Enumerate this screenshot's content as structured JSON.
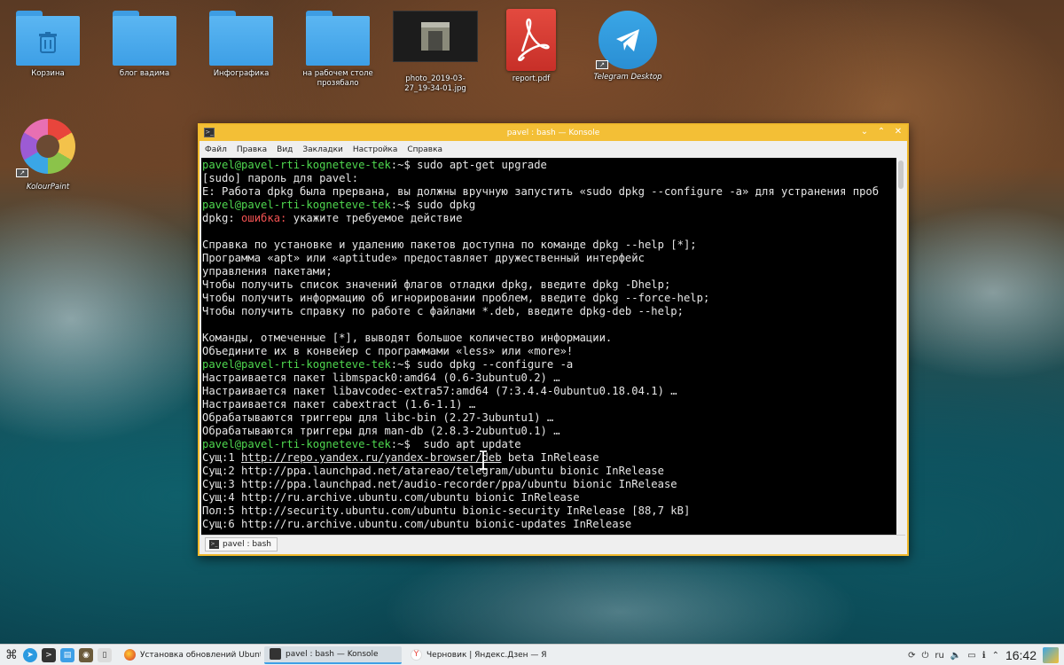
{
  "desktop": {
    "icons": [
      {
        "label": "Корзина",
        "kind": "trash"
      },
      {
        "label": "блог вадима",
        "kind": "folder"
      },
      {
        "label": "Инфографика",
        "kind": "folder"
      },
      {
        "label": "на рабочем столе прозябало",
        "kind": "folder"
      },
      {
        "label": "photo_2019-03-27_19-34-01.jpg",
        "kind": "image"
      },
      {
        "label": "report.pdf",
        "kind": "pdf"
      },
      {
        "label": "Telegram Desktop",
        "kind": "telegram"
      },
      {
        "label": "KolourPaint",
        "kind": "kolourpaint"
      }
    ]
  },
  "window": {
    "title": "pavel : bash — Konsole",
    "menu": [
      "Файл",
      "Правка",
      "Вид",
      "Закладки",
      "Настройка",
      "Справка"
    ],
    "tab_label": "pavel : bash"
  },
  "terminal": {
    "prompt": "pavel@pavel-rti-kogneteve-tek",
    "lines": [
      {
        "p": "pavel@pavel-rti-kogneteve-tek",
        "t": ":~$ sudo apt-get upgrade"
      },
      {
        "t": "[sudo] пароль для pavel:"
      },
      {
        "t": "E: Работа dpkg была прервана, вы должны вручную запустить «sudo dpkg --configure -a» для устранения проб"
      },
      {
        "p": "pavel@pavel-rti-kogneteve-tek",
        "t": ":~$ sudo dpkg"
      },
      {
        "a": "dpkg: ",
        "e": "ошибка:",
        "t": " укажите требуемое действие"
      },
      {
        "t": ""
      },
      {
        "t": "Справка по установке и удалению пакетов доступна по команде dpkg --help [*];"
      },
      {
        "t": "Программа «apt» или «aptitude» предоставляет дружественный интерфейс"
      },
      {
        "t": "управления пакетами;"
      },
      {
        "t": "Чтобы получить список значений флагов отладки dpkg, введите dpkg -Dhelp;"
      },
      {
        "t": "Чтобы получить информацию об игнорировании проблем, введите dpkg --force-help;"
      },
      {
        "t": "Чтобы получить справку по работе с файлами *.deb, введите dpkg-deb --help;"
      },
      {
        "t": ""
      },
      {
        "t": "Команды, отмеченные [*], выводят большое количество информации."
      },
      {
        "t": "Объедините их в конвейер с программами «less» или «more»!"
      },
      {
        "p": "pavel@pavel-rti-kogneteve-tek",
        "t": ":~$ sudo dpkg --configure -a"
      },
      {
        "t": "Настраивается пакет libmspack0:amd64 (0.6-3ubuntu0.2) …"
      },
      {
        "t": "Настраивается пакет libavcodec-extra57:amd64 (7:3.4.4-0ubuntu0.18.04.1) …"
      },
      {
        "t": "Настраивается пакет cabextract (1.6-1.1) …"
      },
      {
        "t": "Обрабатываются триггеры для libc-bin (2.27-3ubuntu1) …"
      },
      {
        "t": "Обрабатываются триггеры для man-db (2.8.3-2ubuntu0.1) …"
      },
      {
        "p": "pavel@pavel-rti-kogneteve-tek",
        "t": ":~$  sudo apt update"
      },
      {
        "a": "Сущ:1 ",
        "u": "http://repo.yandex.ru/yandex-browser/deb",
        "t": " beta InRelease"
      },
      {
        "t": "Сущ:2 http://ppa.launchpad.net/atareao/telegram/ubuntu bionic InRelease"
      },
      {
        "t": "Сущ:3 http://ppa.launchpad.net/audio-recorder/ppa/ubuntu bionic InRelease"
      },
      {
        "t": "Сущ:4 http://ru.archive.ubuntu.com/ubuntu bionic InRelease"
      },
      {
        "t": "Пол:5 http://security.ubuntu.com/ubuntu bionic-security InRelease [88,7 kB]"
      },
      {
        "t": "Сущ:6 http://ru.archive.ubuntu.com/ubuntu bionic-updates InRelease"
      }
    ]
  },
  "taskbar": {
    "tasks": [
      {
        "label": "Установка обновлений Ubuntu |...",
        "icon": "firefox-icon",
        "color": "#e8702a"
      },
      {
        "label": "pavel : bash — Konsole",
        "icon": "konsole-icon",
        "color": "#333333"
      },
      {
        "label": "Черновик | Яндекс.Дзен — Янде...",
        "icon": "yandex-browser-icon",
        "color": "#e8453c"
      }
    ],
    "layout": "ru",
    "clock": "16:42"
  }
}
